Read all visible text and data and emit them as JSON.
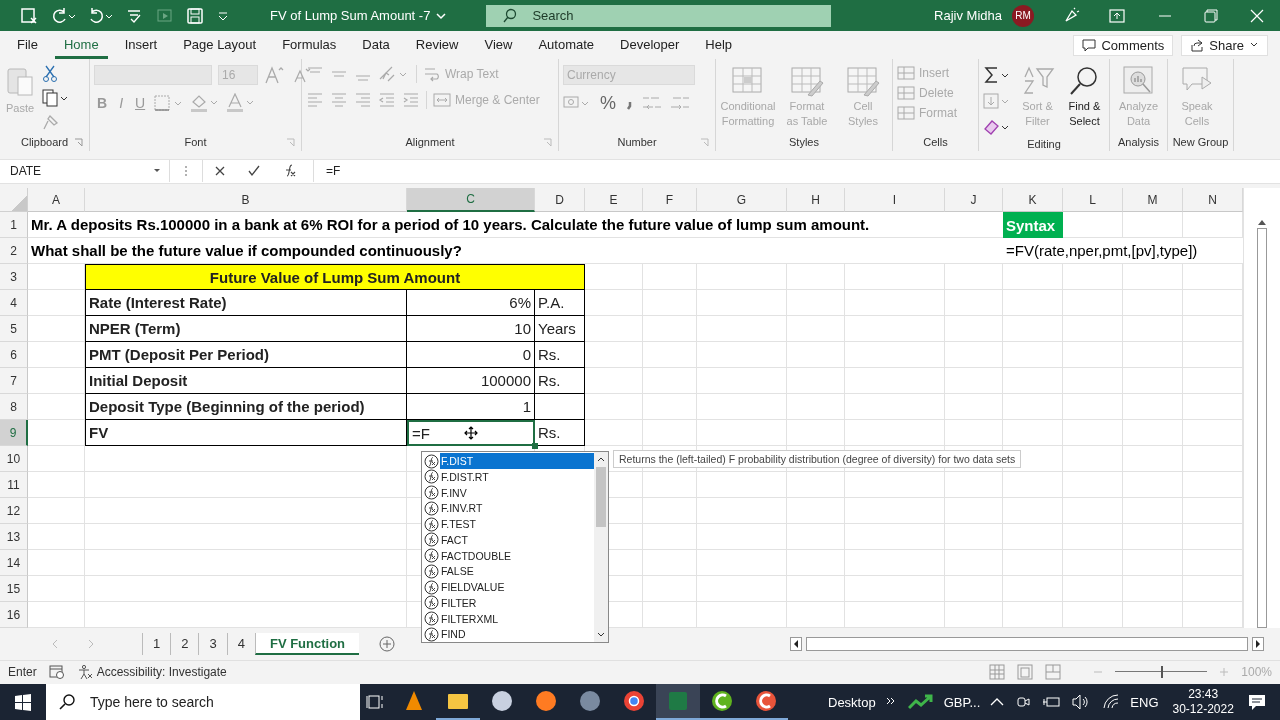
{
  "title_bar": {
    "title": "FV of Lump Sum Amount -7",
    "search_placeholder": "Search",
    "user": "Rajiv Midha",
    "avatar": "RM"
  },
  "menu_tabs": [
    {
      "label": "File",
      "selected": false
    },
    {
      "label": "Home",
      "selected": true
    },
    {
      "label": "Insert",
      "selected": false
    },
    {
      "label": "Page Layout",
      "selected": false
    },
    {
      "label": "Formulas",
      "selected": false
    },
    {
      "label": "Data",
      "selected": false
    },
    {
      "label": "Review",
      "selected": false
    },
    {
      "label": "View",
      "selected": false
    },
    {
      "label": "Automate",
      "selected": false
    },
    {
      "label": "Developer",
      "selected": false
    },
    {
      "label": "Help",
      "selected": false
    }
  ],
  "comments": "Comments",
  "share": "Share",
  "ribbon": {
    "clipboard": {
      "label": "Clipboard",
      "paste": "Paste",
      "disabled": true
    },
    "font": {
      "label": "Font",
      "size": "16",
      "styles": [
        "B",
        "I",
        "U"
      ],
      "disabled": true
    },
    "alignment": {
      "label": "Alignment",
      "wrap": "Wrap Text",
      "merge": "Merge & Center",
      "disabled": true
    },
    "number": {
      "label": "Number",
      "format": "Currency",
      "percent": "%",
      "disabled": true
    },
    "styles": {
      "label": "Styles",
      "buttons": [
        {
          "label": "Conditional Formatting",
          "disabled": true
        },
        {
          "label": "Format as Table",
          "disabled": true
        },
        {
          "label": "Cell Styles",
          "disabled": true
        }
      ]
    },
    "cells": {
      "label": "Cells",
      "buttons": [
        {
          "label": "Insert",
          "disabled": true
        },
        {
          "label": "Delete",
          "disabled": true
        },
        {
          "label": "Format",
          "disabled": true
        }
      ]
    },
    "editing": {
      "label": "Editing",
      "buttons": [
        {
          "label": "Sort & Filter",
          "disabled": true
        },
        {
          "label": "Find & Select",
          "disabled": false
        }
      ]
    },
    "analysis": {
      "label": "Analysis",
      "button": {
        "label": "Analyze Data",
        "disabled": true
      }
    },
    "new_group": {
      "label": "New Group",
      "button": {
        "label": "Speak Cells",
        "disabled": true
      }
    }
  },
  "name_box": "DATE",
  "formula": "=F",
  "columns": [
    {
      "label": "A",
      "selected": false
    },
    {
      "label": "B",
      "selected": false
    },
    {
      "label": "C",
      "selected": true
    },
    {
      "label": "D",
      "selected": false
    },
    {
      "label": "E",
      "selected": false
    },
    {
      "label": "F",
      "selected": false
    },
    {
      "label": "G",
      "selected": false
    },
    {
      "label": "H",
      "selected": false
    },
    {
      "label": "I",
      "selected": false
    },
    {
      "label": "J",
      "selected": false
    },
    {
      "label": "K",
      "selected": false
    },
    {
      "label": "L",
      "selected": false
    },
    {
      "label": "M",
      "selected": false
    },
    {
      "label": "N",
      "selected": false
    }
  ],
  "rows": [
    {
      "label": "1",
      "selected": false
    },
    {
      "label": "2",
      "selected": false
    },
    {
      "label": "3",
      "selected": false
    },
    {
      "label": "4",
      "selected": false
    },
    {
      "label": "5",
      "selected": false
    },
    {
      "label": "6",
      "selected": false
    },
    {
      "label": "7",
      "selected": false
    },
    {
      "label": "8",
      "selected": false
    },
    {
      "label": "9",
      "selected": true
    },
    {
      "label": "10",
      "selected": false
    },
    {
      "label": "11",
      "selected": false
    },
    {
      "label": "12",
      "selected": false
    },
    {
      "label": "13",
      "selected": false
    },
    {
      "label": "14",
      "selected": false
    },
    {
      "label": "15",
      "selected": false
    },
    {
      "label": "16",
      "selected": false
    }
  ],
  "sheet": {
    "line_1": "Mr. A deposits Rs.100000 in a bank  at 6% ROI for a period of 10 years. Calculate the future value of lump sum amount.",
    "line_2": "What shall be the future value if compounded continuously?",
    "syntax_label": "Syntax",
    "syntax": "=FV(rate,nper,pmt,[pv],type])",
    "table_title": "Future Value of Lump Sum Amount",
    "table_rows": [
      {
        "label": "Rate (Interest Rate)",
        "value": "6%",
        "unit": "P.A.",
        "editing": false
      },
      {
        "label": "NPER (Term)",
        "value": "10",
        "unit": "Years",
        "editing": false
      },
      {
        "label": "PMT (Deposit Per Period)",
        "value": "0",
        "unit": "Rs.",
        "editing": false
      },
      {
        "label": "Initial Deposit",
        "value": "100000",
        "unit": "Rs.",
        "editing": false
      },
      {
        "label": "Deposit Type (Beginning of the period)",
        "value": "1",
        "editing": false
      },
      {
        "label": "FV",
        "value": "=F",
        "unit": "Rs.",
        "editing": true
      }
    ]
  },
  "autocomplete": {
    "items": [
      {
        "label": "F.DIST",
        "selected": true
      },
      {
        "label": "F.DIST.RT",
        "selected": false
      },
      {
        "label": "F.INV",
        "selected": false
      },
      {
        "label": "F.INV.RT",
        "selected": false
      },
      {
        "label": "F.TEST",
        "selected": false
      },
      {
        "label": "FACT",
        "selected": false
      },
      {
        "label": "FACTDOUBLE",
        "selected": false
      },
      {
        "label": "FALSE",
        "selected": false
      },
      {
        "label": "FIELDVALUE",
        "selected": false
      },
      {
        "label": "FILTER",
        "selected": false
      },
      {
        "label": "FILTERXML",
        "selected": false
      },
      {
        "label": "FIND",
        "selected": false
      }
    ],
    "tooltip": "Returns the (left-tailed) F probability distribution (degree of diversity) for two data sets"
  },
  "sheet_tabs": [
    {
      "label": "1",
      "selected": false
    },
    {
      "label": "2",
      "selected": false
    },
    {
      "label": "3",
      "selected": false
    },
    {
      "label": "4",
      "selected": false
    },
    {
      "label": "FV Function",
      "selected": true
    }
  ],
  "status_bar": {
    "mode": "Enter",
    "accessibility": "Accessibility: Investigate",
    "zoom": "100%",
    "zoom_slider": {
      "level": 0.5
    }
  },
  "taskbar": {
    "search_placeholder": "Type here to search",
    "apps": [
      {
        "running": false,
        "selected": false
      },
      {
        "running": true,
        "selected": false
      },
      {
        "running": false,
        "selected": false
      },
      {
        "running": false,
        "selected": false
      },
      {
        "running": false,
        "selected": false
      },
      {
        "running": false,
        "selected": false
      },
      {
        "running": true,
        "selected": true
      },
      {
        "running": true,
        "selected": false
      },
      {
        "running": true,
        "selected": false
      }
    ],
    "desktop": "Desktop",
    "ticker": "GBP...",
    "language": "ENG",
    "time": "23:43",
    "date": "30-12-2022"
  }
}
